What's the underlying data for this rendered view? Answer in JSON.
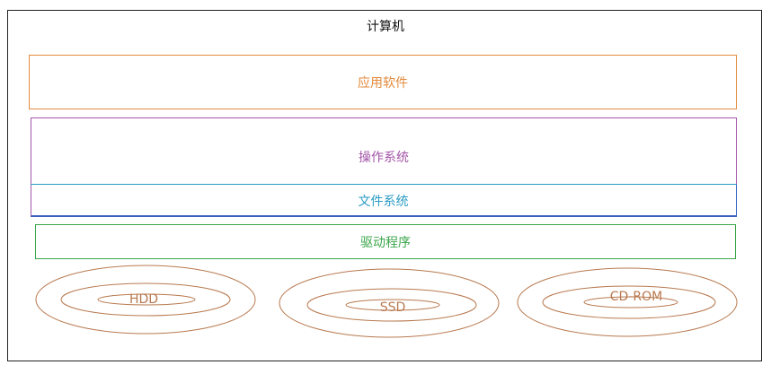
{
  "diagram": {
    "title": "计算机",
    "layers": {
      "application": "应用软件",
      "os": "操作系统",
      "filesystem": "文件系统",
      "driver": "驱动程序"
    },
    "disks": [
      "HDD",
      "SSD",
      "CD-ROM"
    ]
  },
  "colors": {
    "application": "#e28a3c",
    "os": "#a354a8",
    "filesystem": "#2a9bc4",
    "driver": "#3aa64a",
    "disk": "#b8794f"
  }
}
